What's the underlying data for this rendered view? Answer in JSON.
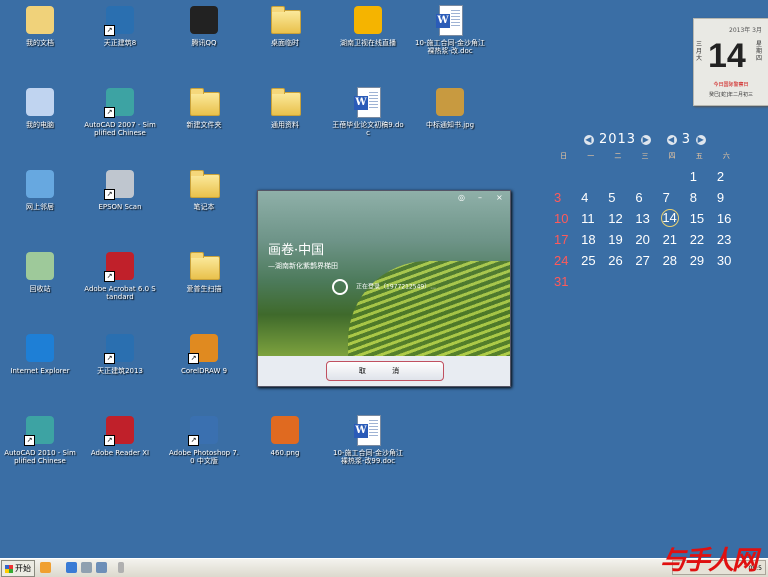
{
  "desktop_icons": [
    {
      "label": "我的文档",
      "icon": "my-documents-icon"
    },
    {
      "label": "天正建筑8",
      "icon": "tangent-building-icon"
    },
    {
      "label": "腾讯QQ",
      "icon": "qq-penguin-icon"
    },
    {
      "label": "桌面临时",
      "icon": "folder-icon"
    },
    {
      "label": "湖南卫视在线直播",
      "icon": "hunan-tv-icon"
    },
    {
      "label": "10-施工合同-金沙角江裸热浆-改.doc",
      "icon": "word-doc-icon"
    },
    {
      "label": "我的电脑",
      "icon": "my-computer-icon"
    },
    {
      "label": "AutoCAD 2007 - Simplified Chinese",
      "icon": "autocad-icon"
    },
    {
      "label": "新建文件夹",
      "icon": "folder-icon"
    },
    {
      "label": "通用资料",
      "icon": "folder-icon"
    },
    {
      "label": "王蓓毕业论文初稿9.doc",
      "icon": "word-doc-icon"
    },
    {
      "label": "中标通知书.jpg",
      "icon": "jpg-file-icon"
    },
    {
      "label": "网上邻居",
      "icon": "network-icon"
    },
    {
      "label": "EPSON Scan",
      "icon": "scanner-icon"
    },
    {
      "label": "笔记本",
      "icon": "folder-icon"
    },
    {
      "label": "回收站",
      "icon": "recycle-bin-icon"
    },
    {
      "label": "Adobe Acrobat 6.0 Standard",
      "icon": "acrobat-icon"
    },
    {
      "label": "爱普生扫描",
      "icon": "folder-icon"
    },
    {
      "label": "Internet Explorer",
      "icon": "ie-icon"
    },
    {
      "label": "天正建筑2013",
      "icon": "tangent-building-icon"
    },
    {
      "label": "CorelDRAW 9",
      "icon": "coreldraw-balloon-icon"
    },
    {
      "label": "AutoCAD 2010 - Simplified Chinese",
      "icon": "autocad-icon"
    },
    {
      "label": "Adobe Reader XI",
      "icon": "adobe-reader-icon"
    },
    {
      "label": "Adobe Photoshop 7.0 中文版",
      "icon": "photoshop-icon"
    },
    {
      "label": "460.png",
      "icon": "png-file-icon"
    },
    {
      "label": "10-施工合同-金沙角江裸热浆-改99.doc",
      "icon": "word-doc-icon"
    }
  ],
  "calendar_widget": {
    "year_month": "2013年 3月",
    "day": "14",
    "month_cn": "三月大",
    "weekday": "星期四",
    "note": "今日国际警察日",
    "lunar": "癸巳[蛇]年二月初三"
  },
  "month_calendar": {
    "year": "2013",
    "month": "3",
    "weekdays": [
      "日",
      "一",
      "二",
      "三",
      "四",
      "五",
      "六"
    ],
    "leading_blanks": 5,
    "days": [
      "1",
      "2",
      "3",
      "4",
      "5",
      "6",
      "7",
      "8",
      "9",
      "10",
      "11",
      "12",
      "13",
      "14",
      "15",
      "16",
      "17",
      "18",
      "19",
      "20",
      "21",
      "22",
      "23",
      "24",
      "25",
      "26",
      "27",
      "28",
      "29",
      "30",
      "31"
    ],
    "today": "14"
  },
  "dialog": {
    "title_main": "画卷·中国",
    "title_sub": "—湖南新化紫鹊界梯田",
    "status": "正在登录（1977212549）...",
    "cancel_label": "取 消",
    "min_glyph": "–",
    "close_glyph": "×",
    "help_glyph": "◎"
  },
  "taskbar": {
    "start_label": "开始",
    "clock": "09:5"
  },
  "watermark": "与手人网"
}
